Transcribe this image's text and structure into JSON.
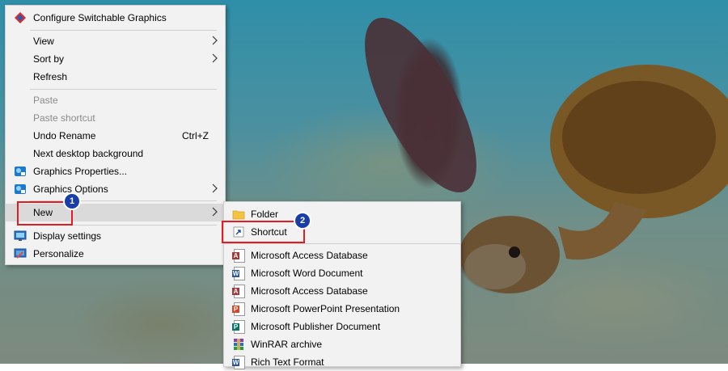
{
  "context_menu": {
    "items": [
      {
        "label": "Configure Switchable Graphics"
      },
      {
        "label": "View"
      },
      {
        "label": "Sort by"
      },
      {
        "label": "Refresh"
      },
      {
        "label": "Paste"
      },
      {
        "label": "Paste shortcut"
      },
      {
        "label": "Undo Rename",
        "shortcut": "Ctrl+Z"
      },
      {
        "label": "Next desktop background"
      },
      {
        "label": "Graphics Properties..."
      },
      {
        "label": "Graphics Options"
      },
      {
        "label": "New"
      },
      {
        "label": "Display settings"
      },
      {
        "label": "Personalize"
      }
    ]
  },
  "new_submenu": {
    "items": [
      {
        "label": "Folder"
      },
      {
        "label": "Shortcut"
      },
      {
        "label": "Microsoft Access Database"
      },
      {
        "label": "Microsoft Word Document"
      },
      {
        "label": "Microsoft Access Database"
      },
      {
        "label": "Microsoft PowerPoint Presentation"
      },
      {
        "label": "Microsoft Publisher Document"
      },
      {
        "label": "WinRAR archive"
      },
      {
        "label": "Rich Text Format"
      }
    ]
  },
  "annotations": {
    "step1": "1",
    "step2": "2",
    "highlight_color": "#e31b23",
    "badge_color": "#1a3ea8"
  },
  "icons": {
    "configure_switchable_graphics": "switchable-graphics-icon",
    "graphics_properties": "intel-graphics-icon",
    "graphics_options": "intel-graphics-icon",
    "display_settings": "monitor-icon",
    "personalize": "personalize-icon",
    "folder": "folder-icon",
    "shortcut": "shortcut-icon",
    "access": "access-icon",
    "word": "word-icon",
    "powerpoint": "powerpoint-icon",
    "publisher": "publisher-icon",
    "winrar": "winrar-icon",
    "rtf": "rtf-icon"
  }
}
